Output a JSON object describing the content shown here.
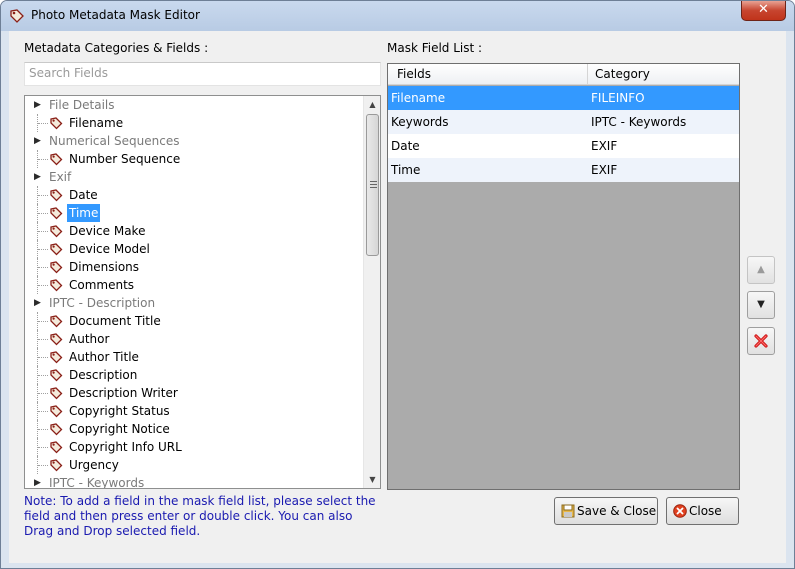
{
  "window": {
    "title": "Photo Metadata Mask Editor",
    "close_glyph": "✕"
  },
  "left": {
    "heading": "Metadata Categories & Fields :",
    "search_placeholder": "Search Fields",
    "tree": [
      {
        "kind": "cat",
        "label": "File Details"
      },
      {
        "kind": "leaf",
        "label": "Filename"
      },
      {
        "kind": "cat",
        "label": "Numerical Sequences"
      },
      {
        "kind": "leaf",
        "label": "Number Sequence"
      },
      {
        "kind": "cat",
        "label": "Exif"
      },
      {
        "kind": "leaf",
        "label": "Date"
      },
      {
        "kind": "leaf",
        "label": "Time",
        "selected": true
      },
      {
        "kind": "leaf",
        "label": "Device Make"
      },
      {
        "kind": "leaf",
        "label": "Device Model"
      },
      {
        "kind": "leaf",
        "label": "Dimensions"
      },
      {
        "kind": "leaf",
        "label": "Comments"
      },
      {
        "kind": "cat",
        "label": "IPTC - Description"
      },
      {
        "kind": "leaf",
        "label": "Document Title"
      },
      {
        "kind": "leaf",
        "label": "Author"
      },
      {
        "kind": "leaf",
        "label": "Author Title"
      },
      {
        "kind": "leaf",
        "label": "Description"
      },
      {
        "kind": "leaf",
        "label": "Description Writer"
      },
      {
        "kind": "leaf",
        "label": "Copyright Status"
      },
      {
        "kind": "leaf",
        "label": "Copyright Notice"
      },
      {
        "kind": "leaf",
        "label": "Copyright Info URL"
      },
      {
        "kind": "leaf",
        "label": "Urgency"
      },
      {
        "kind": "cat",
        "label": "IPTC - Keywords"
      }
    ],
    "note": "Note: To add a field in the mask field list, please select the field and then press enter or double click. You can also Drag and Drop selected field."
  },
  "right": {
    "heading": "Mask Field List :",
    "columns": [
      "Fields",
      "Category"
    ],
    "rows": [
      {
        "field": "Filename",
        "category": "FILEINFO",
        "selected": true
      },
      {
        "field": "Keywords",
        "category": "IPTC - Keywords"
      },
      {
        "field": "Date",
        "category": "EXIF"
      },
      {
        "field": "Time",
        "category": "EXIF"
      }
    ]
  },
  "buttons": {
    "move_up_glyph": "▲",
    "move_down_glyph": "▼",
    "save_close": "Save & Close",
    "close": "Close"
  },
  "colors": {
    "selection": "#3399ff",
    "note_text": "#1a1ab0",
    "grid_background": "#ababab"
  }
}
